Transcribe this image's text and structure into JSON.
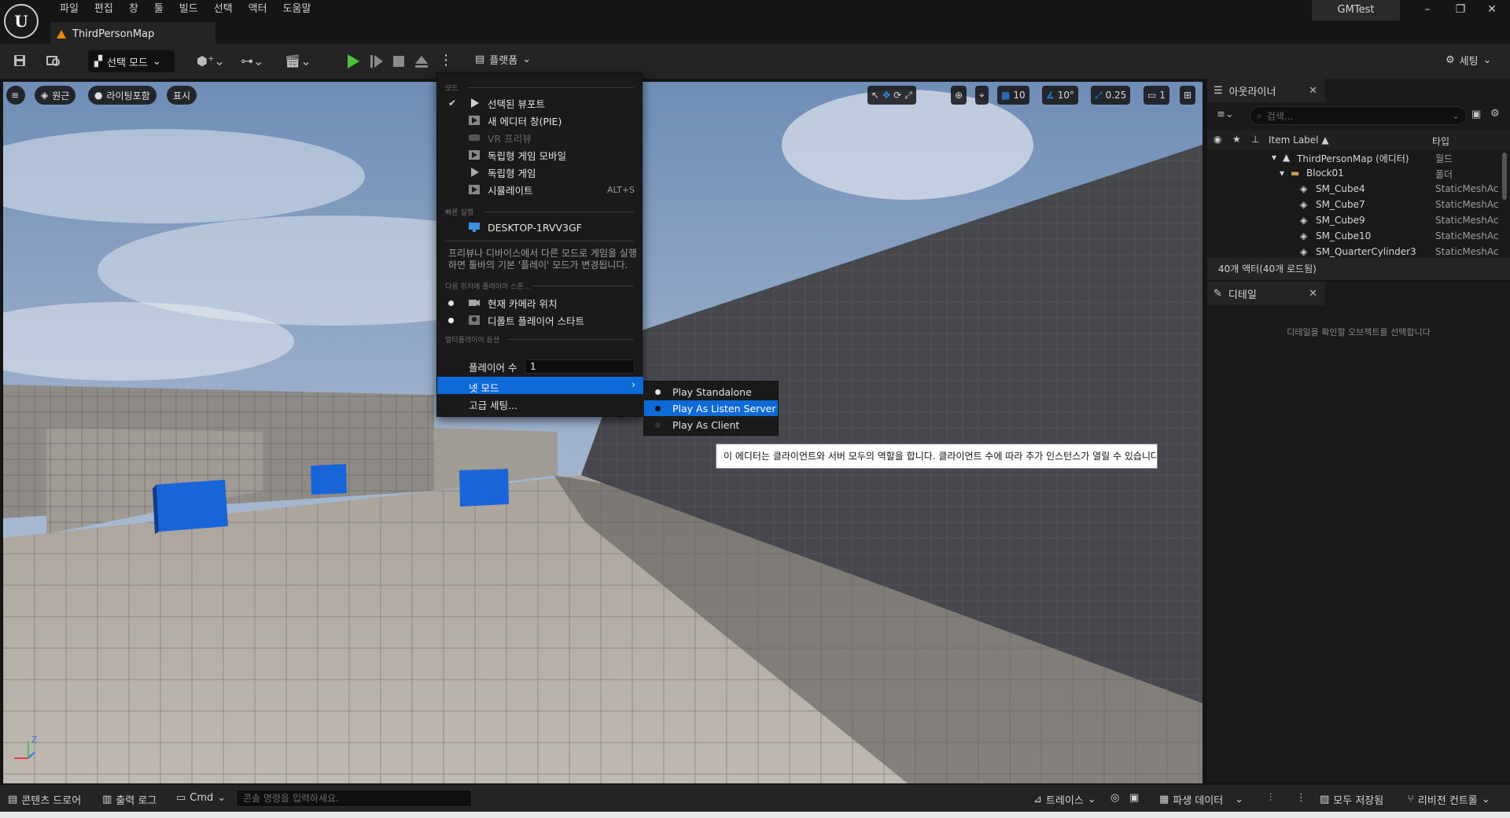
{
  "menubar": [
    "파일",
    "편집",
    "창",
    "툴",
    "빌드",
    "선택",
    "액터",
    "도움말"
  ],
  "doc_tab": "ThirdPersonMap",
  "project_name": "GMTest",
  "toolbar": {
    "mode_label": "선택 모드",
    "platforms_label": "플랫폼",
    "settings_label": "세팅"
  },
  "viewport": {
    "perspective_label": "원근",
    "lighting_label": "라이팅포함",
    "show_label": "표시",
    "grid_snap": "10",
    "rotation_snap": "10°",
    "scale_snap": "0.25",
    "camera_speed": "1"
  },
  "play_menu": {
    "section_mode": "모드",
    "items": [
      {
        "label": "선택된 뷰포트",
        "checked": true
      },
      {
        "label": "새 에디터 창(PIE)"
      },
      {
        "label": "VR 프리뷰",
        "disabled": true
      },
      {
        "label": "독립형 게임 모바일"
      },
      {
        "label": "독립형 게임"
      },
      {
        "label": "시뮬레이트",
        "shortcut": "ALT+S"
      }
    ],
    "section_quick": "빠른 실행",
    "device": "DESKTOP-1RVV3GF",
    "hint": "프리뷰나 디바이스에서 다른 모드로 게임을 실행하면 툴바의 기본 '플레이' 모드가 변경됩니다.",
    "section_spawn": "다음 위치에 플레이어 스폰...",
    "spawn_items": [
      "현재 카메라 위치",
      "디폴트 플레이어 스타트"
    ],
    "section_multi": "멀티플레이어 옵션",
    "players_label": "플레이어 수",
    "players_value": "1",
    "net_mode_label": "넷 모드",
    "advanced_label": "고급 세팅..."
  },
  "net_submenu": [
    "Play Standalone",
    "Play As Listen Server",
    "Play As Client"
  ],
  "tooltip": "이 에디터는 클라이언트와 서버 모두의 역할을 합니다. 클라이언트 수에 따라 추가 인스턴스가 열릴 수 있습니다.",
  "outliner": {
    "tab_label": "아웃라이너",
    "search_placeholder": "검색...",
    "col_label": "Item Label ▲",
    "col_type": "타입",
    "rows": [
      {
        "label": "ThirdPersonMap (에디터)",
        "type": "월드"
      },
      {
        "label": "Block01",
        "type": "폴더"
      },
      {
        "label": "SM_Cube4",
        "type": "StaticMeshActor"
      },
      {
        "label": "SM_Cube7",
        "type": "StaticMeshActor"
      },
      {
        "label": "SM_Cube9",
        "type": "StaticMeshActor"
      },
      {
        "label": "SM_Cube10",
        "type": "StaticMeshActor"
      },
      {
        "label": "SM_QuarterCylinder3",
        "type": "StaticMeshActor"
      }
    ],
    "actor_count": "40개 액터(40개 로드됨)"
  },
  "details": {
    "tab_label": "디테일",
    "empty_msg": "디테일을 확인할 오브젝트를 선택합니다"
  },
  "bottombar": {
    "content_drawer": "콘텐츠 드로어",
    "output_log": "출력 로그",
    "cmd_label": "Cmd",
    "cmd_placeholder": "콘솔 명령을 입력하세요.",
    "trace_label": "트레이스",
    "derived_data": "파생 데이터",
    "save_all": "모두 저장됨",
    "revision_control": "리비전 컨트롤"
  }
}
